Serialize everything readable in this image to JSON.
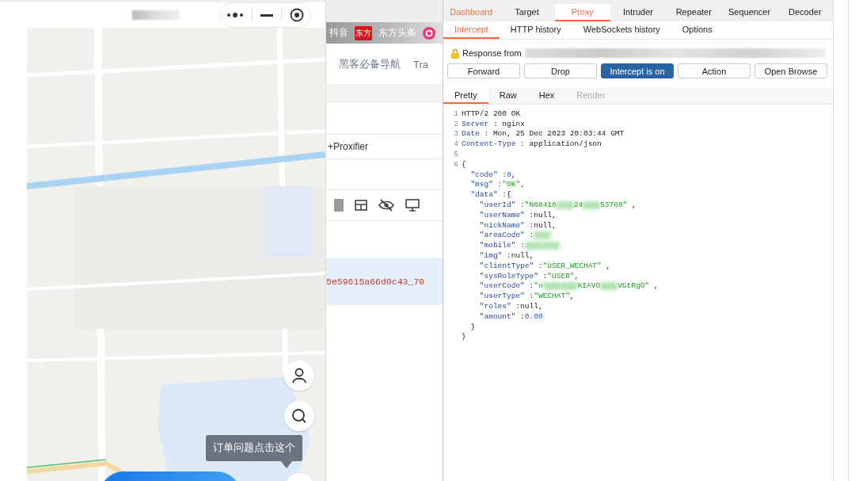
{
  "mini_program": {
    "tooltip": "订单问题点击这个"
  },
  "browser": {
    "bookmarks": [
      {
        "kind": "text",
        "label": "抖音"
      },
      {
        "kind": "logo",
        "label": "东方"
      },
      {
        "kind": "text",
        "label": "东方头条"
      },
      {
        "kind": "icon"
      }
    ],
    "nav": [
      "黑客必备导航",
      "Tra"
    ],
    "extension_label": "+Proxifier",
    "selected_row": "5e59615a66d0c43_70"
  },
  "burp": {
    "tabs": [
      {
        "label": "Dashboard",
        "selected": false,
        "alert": true
      },
      {
        "label": "Target",
        "selected": false,
        "alert": false
      },
      {
        "label": "Proxy",
        "selected": true,
        "alert": false
      },
      {
        "label": "Intruder",
        "selected": false,
        "alert": false
      },
      {
        "label": "Repeater",
        "selected": false,
        "alert": false
      },
      {
        "label": "Sequencer",
        "selected": false,
        "alert": false
      },
      {
        "label": "Decoder",
        "selected": false,
        "alert": false
      }
    ],
    "subtabs": [
      {
        "label": "Intercept",
        "selected": true
      },
      {
        "label": "HTTP history",
        "selected": false
      },
      {
        "label": "WebSockets history",
        "selected": false
      },
      {
        "label": "Options",
        "selected": false
      }
    ],
    "response_label": "Response from",
    "buttons": [
      {
        "label": "Forward",
        "active": false
      },
      {
        "label": "Drop",
        "active": false
      },
      {
        "label": "Intercept is on",
        "active": true
      },
      {
        "label": "Action",
        "active": false
      },
      {
        "label": "Open Browse",
        "active": false
      }
    ],
    "message_tabs": [
      {
        "label": "Pretty",
        "selected": true,
        "disabled": false
      },
      {
        "label": "Raw",
        "selected": false,
        "disabled": false
      },
      {
        "label": "Hex",
        "selected": false,
        "disabled": false
      },
      {
        "label": "Render",
        "selected": false,
        "disabled": true
      }
    ],
    "lines": [
      {
        "number": "1",
        "segments": [
          {
            "kind": "plain",
            "text": "HTTP/2 200 OK"
          }
        ]
      },
      {
        "number": "2",
        "segments": [
          {
            "kind": "header",
            "text": "Server"
          },
          {
            "kind": "plain",
            "text": " : nginx"
          }
        ]
      },
      {
        "number": "3",
        "segments": [
          {
            "kind": "header",
            "text": "Date"
          },
          {
            "kind": "plain",
            "text": " : Mon, 25 Dec 2023 20:03:44 GMT"
          }
        ]
      },
      {
        "number": "4",
        "segments": [
          {
            "kind": "header",
            "text": "Content-Type"
          },
          {
            "kind": "plain",
            "text": " : application/json"
          }
        ]
      },
      {
        "number": "5"
      },
      {
        "number": "6",
        "segments": [
          {
            "kind": "plain",
            "text": "{"
          }
        ]
      },
      {
        "segments": [
          {
            "kind": "key",
            "text": "  \"code\""
          },
          {
            "kind": "plain",
            "text": " :"
          },
          {
            "kind": "number",
            "text": "0"
          },
          {
            "kind": "plain",
            "text": ","
          }
        ]
      },
      {
        "segments": [
          {
            "kind": "key",
            "text": "  \"msg\""
          },
          {
            "kind": "plain",
            "text": " :"
          },
          {
            "kind": "string",
            "text": "\"OK\""
          },
          {
            "kind": "plain",
            "text": ","
          }
        ]
      },
      {
        "segments": [
          {
            "kind": "key",
            "text": "  \"data\""
          },
          {
            "kind": "plain",
            "text": " :{"
          }
        ]
      },
      {
        "segments": [
          {
            "kind": "key",
            "text": "    \"userId\""
          },
          {
            "kind": "plain",
            "text": " :"
          },
          {
            "kind": "string",
            "text": "\"N68410"
          },
          {
            "kind": "blur"
          },
          {
            "kind": "string",
            "text": "24"
          },
          {
            "kind": "blur"
          },
          {
            "kind": "string",
            "text": "53760\""
          },
          {
            "kind": "plain",
            "text": " ,"
          }
        ]
      },
      {
        "segments": [
          {
            "kind": "key",
            "text": "    \"userName\""
          },
          {
            "kind": "plain",
            "text": " :null,"
          }
        ]
      },
      {
        "segments": [
          {
            "kind": "key",
            "text": "    \"nickName\""
          },
          {
            "kind": "plain",
            "text": " :null,"
          }
        ]
      },
      {
        "segments": [
          {
            "kind": "key",
            "text": "    \"areaCode\""
          },
          {
            "kind": "plain",
            "text": " :"
          },
          {
            "kind": "blur"
          }
        ]
      },
      {
        "segments": [
          {
            "kind": "key",
            "text": "    \"mobile\""
          },
          {
            "kind": "plain",
            "text": " :"
          },
          {
            "kind": "blur"
          },
          {
            "kind": "blur"
          }
        ]
      },
      {
        "segments": [
          {
            "kind": "key",
            "text": "    \"img\""
          },
          {
            "kind": "plain",
            "text": " :null,"
          }
        ]
      },
      {
        "segments": [
          {
            "kind": "key",
            "text": "    \"clientType\""
          },
          {
            "kind": "plain",
            "text": " :"
          },
          {
            "kind": "string",
            "text": "\"USER_WECHAT\""
          },
          {
            "kind": "plain",
            "text": " ,"
          }
        ]
      },
      {
        "segments": [
          {
            "kind": "key",
            "text": "    \"sysRoleType\""
          },
          {
            "kind": "plain",
            "text": " :"
          },
          {
            "kind": "string",
            "text": "\"USER\""
          },
          {
            "kind": "plain",
            "text": ","
          }
        ]
      },
      {
        "segments": [
          {
            "kind": "key",
            "text": "    \"userCode\""
          },
          {
            "kind": "plain",
            "text": " :"
          },
          {
            "kind": "string",
            "text": "\"o"
          },
          {
            "kind": "blur"
          },
          {
            "kind": "blur"
          },
          {
            "kind": "string",
            "text": "KIAVO"
          },
          {
            "kind": "blur"
          },
          {
            "kind": "string",
            "text": "VGtRgO\""
          },
          {
            "kind": "plain",
            "text": " ,"
          }
        ]
      },
      {
        "segments": [
          {
            "kind": "key",
            "text": "    \"userType\""
          },
          {
            "kind": "plain",
            "text": " :"
          },
          {
            "kind": "string",
            "text": "\"WECHAT\""
          },
          {
            "kind": "plain",
            "text": ","
          }
        ]
      },
      {
        "segments": [
          {
            "kind": "key",
            "text": "    \"roles\""
          },
          {
            "kind": "plain",
            "text": " :null,"
          }
        ]
      },
      {
        "segments": [
          {
            "kind": "key",
            "text": "    \"amount\""
          },
          {
            "kind": "plain",
            "text": " :"
          },
          {
            "kind": "number",
            "text": "0.00"
          }
        ]
      },
      {
        "segments": [
          {
            "kind": "plain",
            "text": "  }"
          }
        ]
      },
      {
        "segments": [
          {
            "kind": "plain",
            "text": "}"
          }
        ]
      }
    ]
  }
}
